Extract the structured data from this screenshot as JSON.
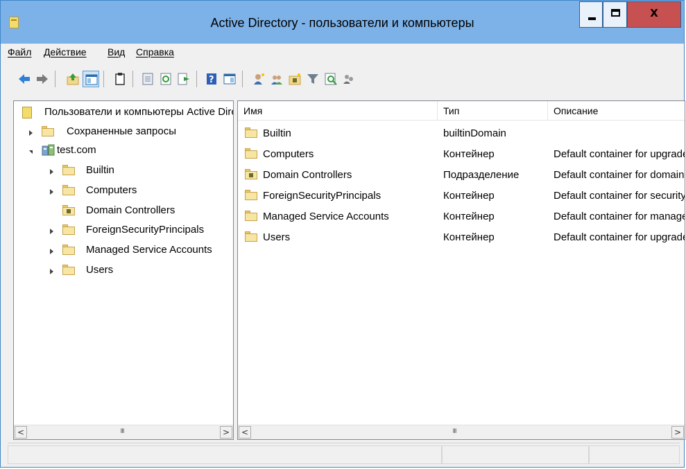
{
  "window": {
    "title": "Active Directory - пользователи и компьютеры",
    "close_label": "X",
    "accent": "#7db2e8"
  },
  "menu": {
    "items": [
      "Файл",
      "Действие",
      "Вид",
      "Справка"
    ]
  },
  "toolbar": {
    "icons": [
      "back-icon",
      "forward-icon",
      "up-icon",
      "show-hide-tree-icon",
      "clipboard-icon",
      "properties-icon",
      "refresh-icon",
      "export-list-icon",
      "help-icon",
      "console-icon",
      "new-user-icon",
      "new-group-icon",
      "new-ou-icon",
      "filter-icon",
      "find-icon",
      "delegate-icon"
    ]
  },
  "tree": {
    "root": "Пользователи и компьютеры Active Directory",
    "saved_queries": "Сохраненные запросы",
    "domain": "test.com",
    "children": [
      "Builtin",
      "Computers",
      "Domain Controllers",
      "ForeignSecurityPrincipals",
      "Managed Service Accounts",
      "Users"
    ]
  },
  "list": {
    "columns": [
      "Имя",
      "Тип",
      "Описание"
    ],
    "rows": [
      {
        "name": "Builtin",
        "type": "builtinDomain",
        "description": ""
      },
      {
        "name": "Computers",
        "type": "Контейнер",
        "description": "Default container for upgraded computer accounts"
      },
      {
        "name": "Domain Controllers",
        "type": "Подразделение",
        "description": "Default container for domain controllers"
      },
      {
        "name": "ForeignSecurityPrincipals",
        "type": "Контейнер",
        "description": "Default container for security identifiers"
      },
      {
        "name": "Managed Service Accounts",
        "type": "Контейнер",
        "description": "Default container for managed service accounts"
      },
      {
        "name": "Users",
        "type": "Контейнер",
        "description": "Default container for upgraded user accounts"
      }
    ]
  },
  "scroll": {
    "left_arrow": "<",
    "right_arrow": ">",
    "thumb_grip": "III"
  }
}
